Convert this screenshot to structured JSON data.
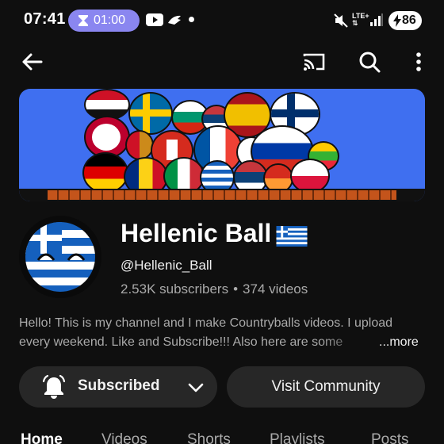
{
  "status_bar": {
    "time": "07:41",
    "timer": "01:00",
    "network": "LTE+",
    "battery_level": "86"
  },
  "app_bar": {
    "back_icon": "arrow-left-icon",
    "cast_icon": "cast-icon",
    "search_icon": "search-icon",
    "more_icon": "more-vert-icon"
  },
  "channel": {
    "name": "Hellenic Ball",
    "handle": "@Hellenic_Ball",
    "subscribers": "2.53K subscribers",
    "separator": "•",
    "videos": "374 videos",
    "description_line1": "Hello! This is my channel and I make Countryballs videos. I upload",
    "description_line2": "every weekend. Like and Subscribe!!! Also here are some",
    "more_label": "...more"
  },
  "actions": {
    "subscribed_label": "Subscribed",
    "community_label": "Visit Community"
  },
  "tabs": [
    "Home",
    "Videos",
    "Shorts",
    "Playlists",
    "Posts"
  ],
  "colors": {
    "background": "#0f0f0f",
    "button_bg": "#272727",
    "timer_pill": "#8a86f0",
    "banner_sky": "#3f6ff0"
  }
}
